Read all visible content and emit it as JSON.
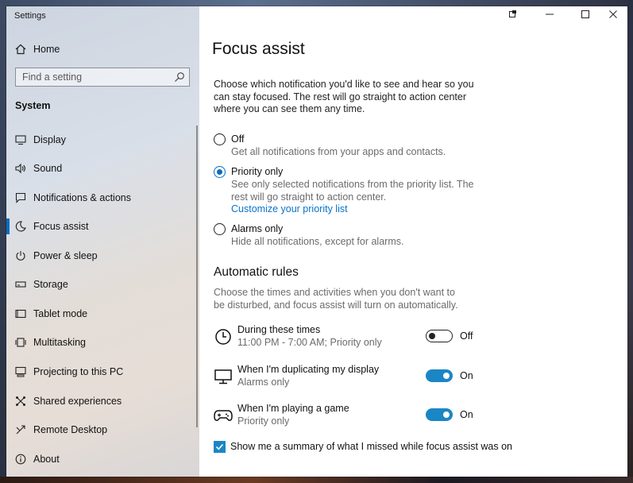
{
  "window": {
    "app_title": "Settings",
    "controls": [
      "snap",
      "minimize",
      "maximize",
      "close"
    ]
  },
  "sidebar": {
    "home_label": "Home",
    "search_placeholder": "Find a setting",
    "section_title": "System",
    "items": [
      {
        "label": "Display",
        "icon": "display-icon",
        "selected": false
      },
      {
        "label": "Sound",
        "icon": "sound-icon",
        "selected": false
      },
      {
        "label": "Notifications & actions",
        "icon": "notifications-icon",
        "selected": false
      },
      {
        "label": "Focus assist",
        "icon": "moon-icon",
        "selected": true
      },
      {
        "label": "Power & sleep",
        "icon": "power-icon",
        "selected": false
      },
      {
        "label": "Storage",
        "icon": "storage-icon",
        "selected": false
      },
      {
        "label": "Tablet mode",
        "icon": "tablet-icon",
        "selected": false
      },
      {
        "label": "Multitasking",
        "icon": "multitasking-icon",
        "selected": false
      },
      {
        "label": "Projecting to this PC",
        "icon": "projecting-icon",
        "selected": false
      },
      {
        "label": "Shared experiences",
        "icon": "shared-icon",
        "selected": false
      },
      {
        "label": "Remote Desktop",
        "icon": "remote-desktop-icon",
        "selected": false
      },
      {
        "label": "About",
        "icon": "info-icon",
        "selected": false
      }
    ]
  },
  "main": {
    "title": "Focus assist",
    "intro": "Choose which notification you'd like to see and hear so you can stay focused. The rest will go straight to action center where you can see them any time.",
    "options": [
      {
        "label": "Off",
        "description": "Get all notifications from your apps and contacts.",
        "checked": false
      },
      {
        "label": "Priority only",
        "description": "See only selected notifications from the priority list. The rest will go straight to action center.",
        "link": "Customize your priority list",
        "checked": true
      },
      {
        "label": "Alarms only",
        "description": "Hide all notifications, except for alarms.",
        "checked": false
      }
    ],
    "rules_title": "Automatic rules",
    "rules_description": "Choose the times and activities when you don't want to be disturbed, and focus assist will turn on automatically.",
    "rules": [
      {
        "title": "During these times",
        "subtitle": "11:00 PM - 7:00 AM; Priority only",
        "state": "Off",
        "icon": "clock-icon"
      },
      {
        "title": "When I'm duplicating my display",
        "subtitle": "Alarms only",
        "state": "On",
        "icon": "monitor-icon"
      },
      {
        "title": "When I'm playing a game",
        "subtitle": "Priority only",
        "state": "On",
        "icon": "gamepad-icon"
      }
    ],
    "summary_checkbox": {
      "label": "Show me a summary of what I missed while focus assist was on",
      "checked": true
    }
  },
  "colors": {
    "accent": "#0a6cbf",
    "toggle_on": "#1b86c4",
    "link": "#0a74c9"
  }
}
